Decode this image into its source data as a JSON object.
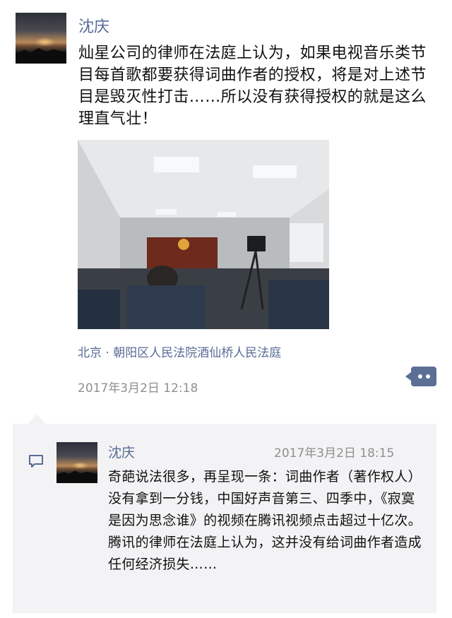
{
  "post": {
    "username": "沈庆",
    "text": "灿星公司的律师在法庭上认为，如果电视音乐类节目每首歌都要获得词曲作者的授权，将是对上述节目是毁灭性打击……所以没有获得授权的就是这么理直气壮！",
    "location": "北京 · 朝阳区人民法院酒仙桥人民法庭",
    "timestamp": "2017年3月2日 12:18"
  },
  "comment": {
    "username": "沈庆",
    "timestamp": "2017年3月2日 18:15",
    "text": "奇葩说法很多，再呈现一条：词曲作者（著作权人）没有拿到一分钱，中国好声音第三、四季中，《寂寞是因为思念谁》的视频在腾讯视频点击超过十亿次。腾讯的律师在法庭上认为，这并没有给词曲作者造成任何经济损失……"
  },
  "icons": {
    "more": "more-dots-icon",
    "comment": "comment-bubble-icon"
  },
  "colors": {
    "link": "#586b95",
    "timestamp": "#8f8f8f",
    "comment_bg": "#f3f3f5"
  }
}
